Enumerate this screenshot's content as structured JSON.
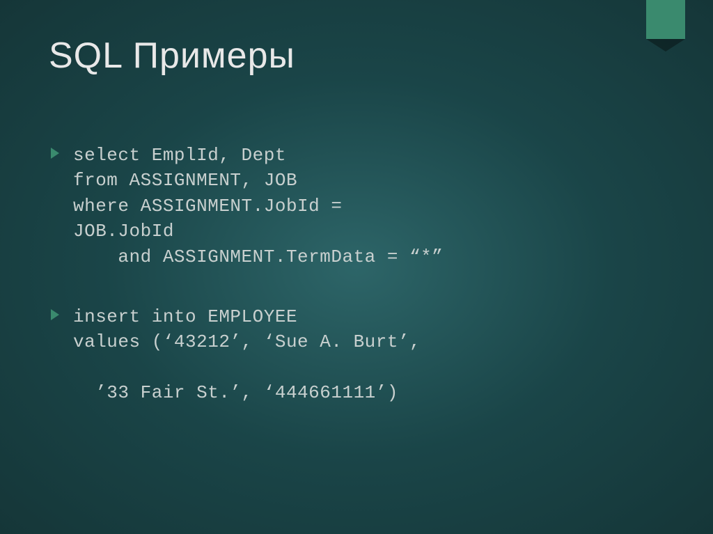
{
  "title": "SQL Примеры",
  "bullets": [
    {
      "code": "select EmplId, Dept\nfrom ASSIGNMENT, JOB\nwhere ASSIGNMENT.JobId =\nJOB.JobId\n    and ASSIGNMENT.TermData = “*”"
    },
    {
      "code": "insert into EMPLOYEE\nvalues (‘43212’, ‘Sue A. Burt’,\n\n  ’33 Fair St.’, ‘444661111’)"
    }
  ]
}
